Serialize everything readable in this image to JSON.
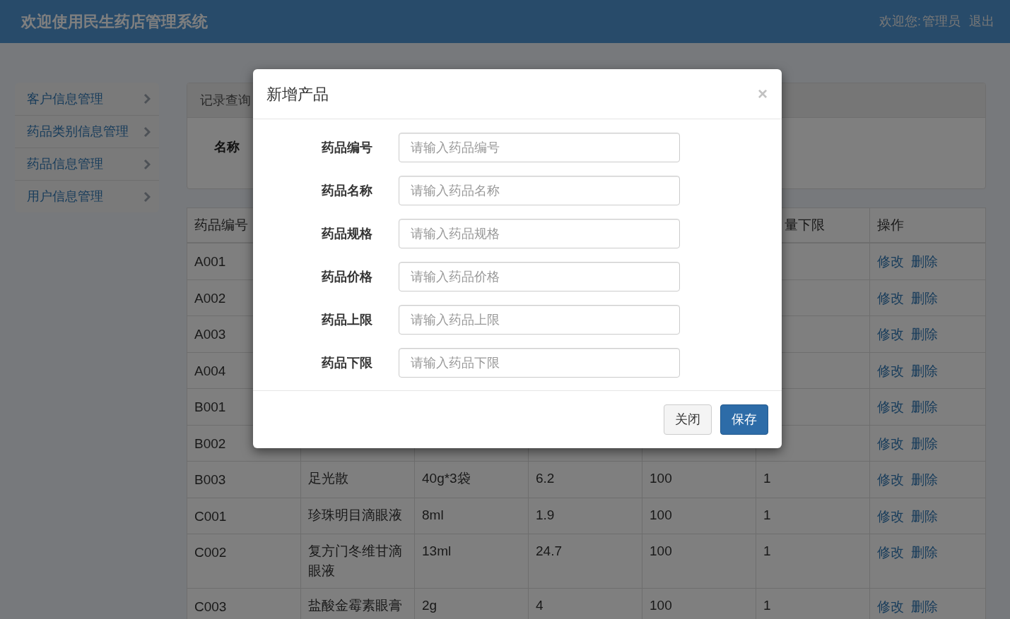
{
  "header": {
    "title": "欢迎使用民生药店管理系统",
    "welcome": "欢迎您:",
    "user": "管理员",
    "logout": "退出"
  },
  "sidebar": {
    "items": [
      {
        "label": "客户信息管理"
      },
      {
        "label": "药品类别信息管理"
      },
      {
        "label": "药品信息管理"
      },
      {
        "label": "用户信息管理"
      }
    ]
  },
  "query_panel": {
    "title": "记录查询",
    "field_label": "名称"
  },
  "table": {
    "header_first": "药品编号",
    "header_sixth": "量下限",
    "header_last": "操作",
    "rows": [
      {
        "code": "A001",
        "actions": [
          "修改",
          "删除"
        ]
      },
      {
        "code": "A002",
        "actions": [
          "修改",
          "删除"
        ]
      },
      {
        "code": "A003",
        "actions": [
          "修改",
          "删除"
        ]
      },
      {
        "code": "A004",
        "actions": [
          "修改",
          "删除"
        ]
      },
      {
        "code": "B001",
        "actions": [
          "修改",
          "删除"
        ]
      },
      {
        "code": "B002",
        "actions": [
          "修改",
          "删除"
        ]
      },
      {
        "code": "B003",
        "cells": [
          "足光散",
          "40g*3袋",
          "6.2",
          "100",
          "1"
        ],
        "actions": [
          "修改",
          "删除"
        ]
      },
      {
        "code": "C001",
        "cells": [
          "珍珠明目滴眼液",
          "8ml",
          "1.9",
          "100",
          "1"
        ],
        "actions": [
          "修改",
          "删除"
        ]
      },
      {
        "code": "C002",
        "cells": [
          "复方门冬维甘滴眼液",
          "13ml",
          "24.7",
          "100",
          "1"
        ],
        "actions": [
          "修改",
          "删除"
        ]
      },
      {
        "code": "C003",
        "cells": [
          "盐酸金霉素眼膏",
          "2g",
          "4",
          "100",
          "1"
        ],
        "actions": [
          "修改",
          "删除"
        ]
      }
    ]
  },
  "modal": {
    "title": "新增产品",
    "close": "×",
    "fields": [
      {
        "label": "药品编号",
        "placeholder": "请输入药品编号"
      },
      {
        "label": "药品名称",
        "placeholder": "请输入药品名称"
      },
      {
        "label": "药品规格",
        "placeholder": "请输入药品规格"
      },
      {
        "label": "药品价格",
        "placeholder": "请输入药品价格"
      },
      {
        "label": "药品上限",
        "placeholder": "请输入药品上限"
      },
      {
        "label": "药品下限",
        "placeholder": "请输入药品下限"
      }
    ],
    "buttons": [
      {
        "label": "关闭",
        "kind": "default"
      },
      {
        "label": "保存",
        "kind": "primary"
      }
    ]
  }
}
